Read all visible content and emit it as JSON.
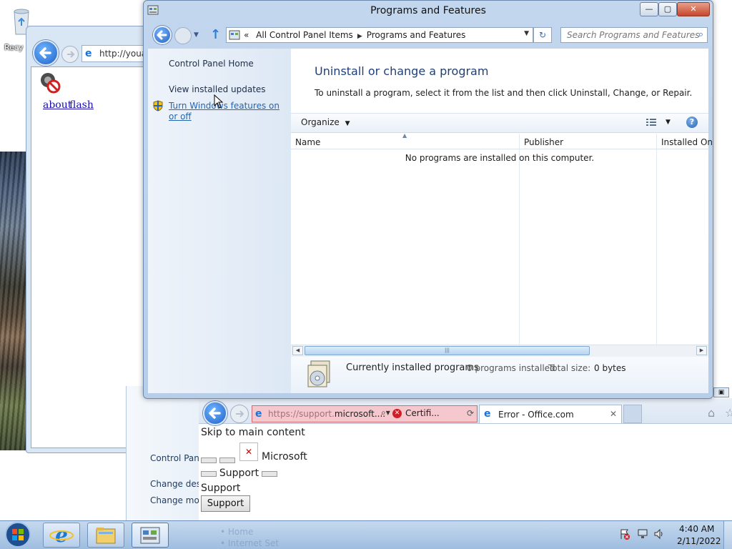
{
  "desktop": {
    "recycle_label": "Recy"
  },
  "ie_left": {
    "address": "http://youa",
    "links": [
      "about",
      "flash"
    ]
  },
  "cp_behind": {
    "items": [
      "Control Pan",
      "Change des",
      "Change mo"
    ]
  },
  "ie_bottom": {
    "address_prefix": "https://support.",
    "address_domain": "microsoft....",
    "cert_label": "Certifi...",
    "tab_title": "Error - Office.com",
    "skip_link": "Skip to main content",
    "brand": "Microsoft",
    "support_label_1": "Support",
    "support_label_2": "Support",
    "support_button": "Support"
  },
  "window": {
    "title": "Programs and Features",
    "minimize": "—",
    "maximize": "▢",
    "close": "✕"
  },
  "breadcrumb": {
    "overflow": "«",
    "items": [
      "All Control Panel Items",
      "Programs and Features"
    ]
  },
  "search": {
    "placeholder": "Search Programs and Features"
  },
  "sidebar": {
    "home": "Control Panel Home",
    "updates": "View installed updates",
    "features": "Turn Windows features on or off"
  },
  "main": {
    "heading": "Uninstall or change a program",
    "description": "To uninstall a program, select it from the list and then click Uninstall, Change, or Repair.",
    "organize": "Organize",
    "columns": [
      "Name",
      "Publisher",
      "Installed On"
    ],
    "empty_message": "No programs are installed on this computer."
  },
  "details": {
    "title": "Currently installed programs",
    "count": "0 programs installed",
    "size_label": "Total size:",
    "size_value": "0 bytes"
  },
  "taskbar": {
    "time": "4:40 AM",
    "date": "2/11/2022",
    "ghost_items": [
      "• Home",
      "• Internet Set"
    ]
  }
}
